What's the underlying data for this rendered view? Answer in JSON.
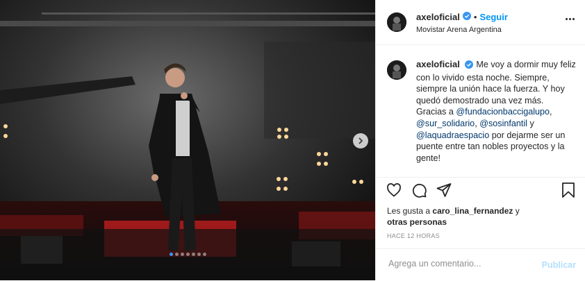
{
  "post": {
    "username": "axeloficial",
    "follow_label": "Seguir",
    "location": "Movistar Arena Argentina",
    "caption": {
      "text_1": "Me voy a dormir muy feliz con lo vivido esta noche. Siempre, siempre la unión hace la fuerza. Y hoy quedó demostrado una vez más.",
      "text_2": "Gracias a ",
      "mention_1": "@fundacionbaccigalupo",
      "comma_1": ", ",
      "mention_2": "@sur_solidario",
      "comma_2": ", ",
      "mention_3": "@sosinfantil",
      "and": " y ",
      "mention_4": "@laquadraespacio",
      "text_3": " por dejarme ser un puente entre tan nobles proyectos y la gente!"
    },
    "likes": {
      "prefix": "Les gusta a ",
      "user": "caro_lina_fernandez",
      "mid": " y ",
      "others": "otras personas"
    },
    "timestamp": "HACE 12 HORAS",
    "comment_placeholder": "Agrega un comentario...",
    "publish_label": "Publicar",
    "carousel": {
      "count": 7,
      "active_index": 0
    }
  },
  "colors": {
    "accent_blue": "#0095f6",
    "verified_blue": "#3897f0",
    "mention": "#00376b",
    "publish_disabled": "#b2dffc"
  },
  "icons": [
    "verified-icon",
    "more-options-icon",
    "heart-icon",
    "comment-icon",
    "share-icon",
    "bookmark-icon",
    "chevron-right-icon"
  ]
}
